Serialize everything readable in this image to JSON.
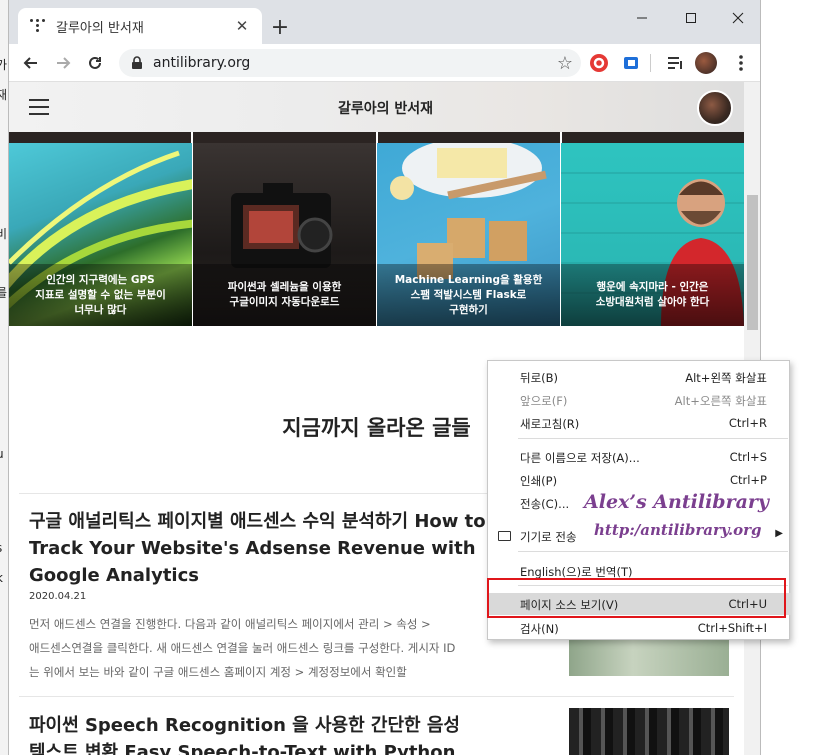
{
  "browser": {
    "tab_title": "갈루아의 반서재",
    "new_tab_label": "+",
    "url": "antilibrary.org"
  },
  "site": {
    "title": "갈루아의 반서재"
  },
  "cards": [
    {
      "caption_lines": [
        "인간의 지구력에는 GPS",
        "지표로 설명할 수 없는 부분이",
        "너무나 많다"
      ]
    },
    {
      "caption_lines": [
        "파이썬과 셀레늄을 이용한",
        "구글이미지 자동다운로드"
      ]
    },
    {
      "caption_lines": [
        "Machine Learning을 활용한",
        "스팸 적발시스템 Flask로",
        "구현하기"
      ]
    },
    {
      "caption_lines": [
        "행운에 속지마라 - 인간은",
        "소방대원처럼 살아야 한다"
      ]
    }
  ],
  "section_title": "지금까지 올라온 글들",
  "posts": [
    {
      "title_lines": [
        "구글 애널리틱스 페이지별 애드센스 수익 분석하기 How to",
        "Track Your Website's Adsense Revenue with",
        "Google Analytics"
      ],
      "date": "2020.04.21",
      "excerpt_lines": [
        "먼저 애드센스 연결을 진행한다. 다음과 같이 애널리틱스 페이지에서 관리 > 속성 >",
        "애드센스연결을 클릭한다. 새 애드센스 연결을 눌러 애드센스 링크를 구성한다. 게시자 ID",
        "는 위에서 보는 바와 같이 구글 애드센스 홈페이지 계정 > 계정정보에서 확인할"
      ]
    },
    {
      "title_lines": [
        "파이썬 Speech Recognition 을 사용한 간단한 음성",
        "텍스트 변환 Easy Speech-to-Text with Python"
      ]
    }
  ],
  "context_menu": {
    "items": [
      {
        "label": "뒤로(B)",
        "shortcut": "Alt+왼쪽 화살표",
        "disabled": false
      },
      {
        "label": "앞으로(F)",
        "shortcut": "Alt+오른쪽 화살표",
        "disabled": true
      },
      {
        "label": "새로고침(R)",
        "shortcut": "Ctrl+R",
        "disabled": false
      },
      {
        "label": "다른 이름으로 저장(A)...",
        "shortcut": "Ctrl+S",
        "disabled": false
      },
      {
        "label": "인쇄(P)",
        "shortcut": "Ctrl+P",
        "disabled": false
      },
      {
        "label": "전송(C)...",
        "shortcut": "",
        "disabled": false
      },
      {
        "label": "기기로 전송",
        "shortcut": "",
        "disabled": false
      },
      {
        "label": "English(으)로 번역(T)",
        "shortcut": "",
        "disabled": false
      },
      {
        "label": "페이지 소스 보기(V)",
        "shortcut": "Ctrl+U",
        "disabled": false
      },
      {
        "label": "검사(N)",
        "shortcut": "Ctrl+Shift+I",
        "disabled": false
      }
    ]
  },
  "watermark": {
    "line1": "Alex’s Antilibrary",
    "line2": "http:/antilibrary.org"
  },
  "background_text": [
    "가",
    "재",
    "비",
    "를",
    "u",
    "s",
    "k"
  ],
  "colors": {
    "highlight_box": "#e0161b",
    "watermark": "#7b3f8f"
  }
}
